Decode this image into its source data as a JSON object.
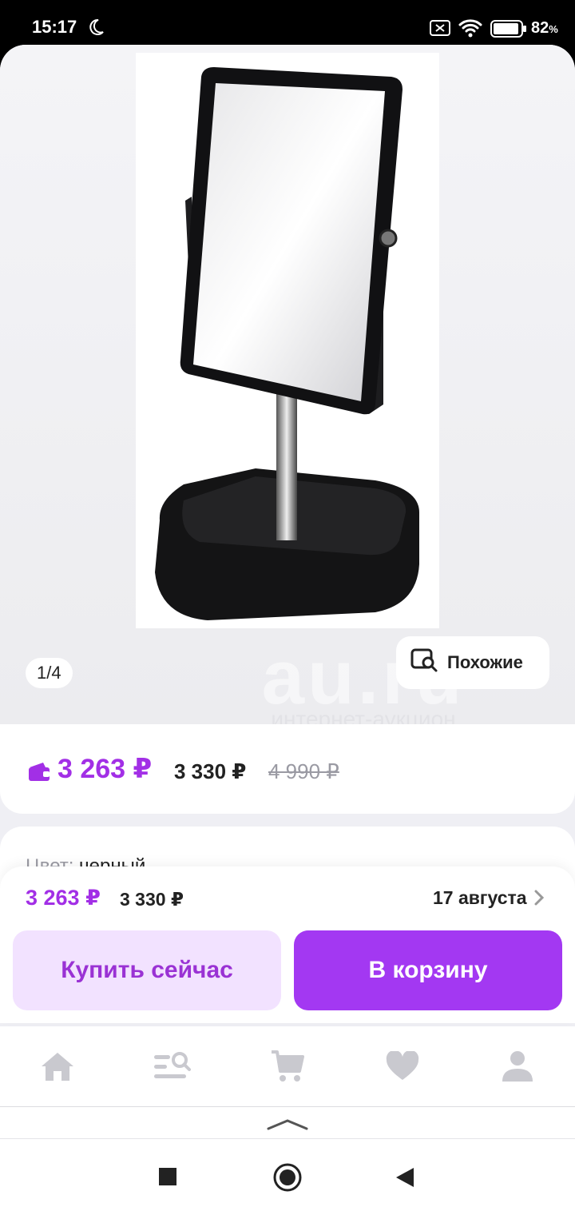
{
  "status_bar": {
    "time": "15:17",
    "battery_percent": "82",
    "battery_unit": "%",
    "icons": [
      "moon-icon",
      "sim-off-icon",
      "wifi-icon",
      "battery-icon"
    ]
  },
  "gallery": {
    "counter": "1/4",
    "similar_label": "Похожие",
    "watermark_logo": "au.ru",
    "watermark_subtitle": "интернет-аукцион"
  },
  "prices": {
    "main": "3 263 ₽",
    "second": "3 330 ₽",
    "old": "4 990 ₽"
  },
  "attributes": {
    "color_label": "Цвет:",
    "color_value": "черный"
  },
  "buy_panel": {
    "price": "3 263 ₽",
    "price_second": "3 330 ₽",
    "delivery_date": "17 августа",
    "buy_now_label": "Купить сейчас",
    "add_to_cart_label": "В корзину"
  },
  "tab_bar": {
    "tabs": [
      "home-icon",
      "catalog-search-icon",
      "cart-icon",
      "favorites-icon",
      "profile-icon"
    ]
  },
  "colors": {
    "accent": "#a338f2",
    "accent_light": "#f2e2ff",
    "price": "#a22fe6"
  }
}
